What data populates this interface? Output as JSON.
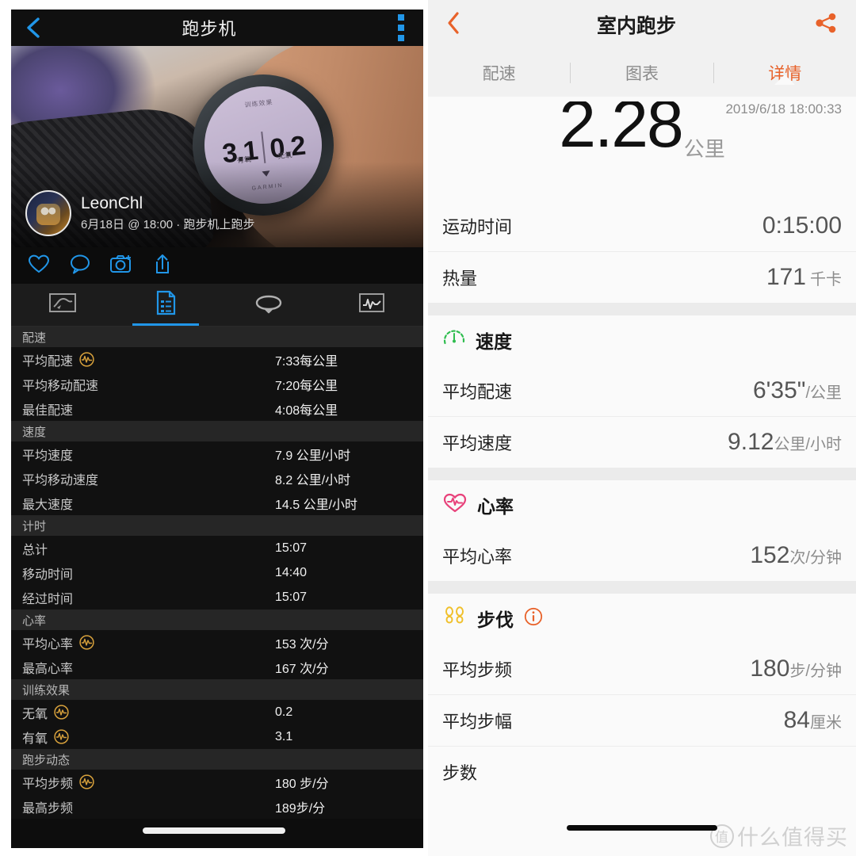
{
  "left_panel": {
    "appbar": {
      "title": "跑步机",
      "back_icon": "chevron-left-icon",
      "menu_icon": "overflow-menu-icon"
    },
    "post": {
      "user_name": "LeonChl",
      "subtitle": "6月18日 @ 18:00 · 跑步机上跑步",
      "watch": {
        "top_label": "训练效果",
        "value_left": "3.1",
        "value_right": "0.2",
        "label_left": "有氧",
        "label_right": "无氧",
        "brand": "GARMIN"
      }
    },
    "actions": [
      {
        "name": "like-icon",
        "label": "heart"
      },
      {
        "name": "comment-icon",
        "label": "comment"
      },
      {
        "name": "camera-icon",
        "label": "camera"
      },
      {
        "name": "share-icon",
        "label": "share"
      }
    ],
    "tabs": [
      {
        "name": "tab-map",
        "icon": "map-icon",
        "active": false
      },
      {
        "name": "tab-details",
        "icon": "document-list-icon",
        "active": true
      },
      {
        "name": "tab-laps",
        "icon": "loop-icon",
        "active": false
      },
      {
        "name": "tab-graphs",
        "icon": "graph-icon",
        "active": false
      }
    ],
    "sections": [
      {
        "title": "配速",
        "rows": [
          {
            "label": "平均配速",
            "value": "7:33每公里",
            "badge": "garmin-wave-icon"
          },
          {
            "label": "平均移动配速",
            "value": "7:20每公里",
            "badge": null
          },
          {
            "label": "最佳配速",
            "value": "4:08每公里",
            "badge": null
          }
        ]
      },
      {
        "title": "速度",
        "rows": [
          {
            "label": "平均速度",
            "value": "7.9 公里/小时",
            "badge": null
          },
          {
            "label": "平均移动速度",
            "value": "8.2 公里/小时",
            "badge": null
          },
          {
            "label": "最大速度",
            "value": "14.5 公里/小时",
            "badge": null
          }
        ]
      },
      {
        "title": "计时",
        "rows": [
          {
            "label": "总计",
            "value": "15:07",
            "badge": null
          },
          {
            "label": "移动时间",
            "value": "14:40",
            "badge": null
          },
          {
            "label": "经过时间",
            "value": "15:07",
            "badge": null
          }
        ]
      },
      {
        "title": "心率",
        "rows": [
          {
            "label": "平均心率",
            "value": "153 次/分",
            "badge": "garmin-wave-icon"
          },
          {
            "label": "最高心率",
            "value": "167 次/分",
            "badge": null
          }
        ]
      },
      {
        "title": "训练效果",
        "rows": [
          {
            "label": "无氧",
            "value": "0.2",
            "badge": "garmin-wave-icon"
          },
          {
            "label": "有氧",
            "value": "3.1",
            "badge": "garmin-wave-icon"
          }
        ]
      },
      {
        "title": "跑步动态",
        "rows": [
          {
            "label": "平均步频",
            "value": "180 步/分",
            "badge": "garmin-wave-icon"
          },
          {
            "label": "最高步频",
            "value": "189步/分",
            "badge": null
          }
        ]
      }
    ]
  },
  "right_panel": {
    "appbar": {
      "title": "室内跑步",
      "back_icon": "chevron-left-icon",
      "share_icon": "share-nodes-icon"
    },
    "tabs": [
      {
        "label": "配速",
        "active": false
      },
      {
        "label": "图表",
        "active": false
      },
      {
        "label": "详情",
        "active": true
      }
    ],
    "hero": {
      "timestamp": "2019/6/18 18:00:33",
      "value": "2.28",
      "unit": "公里"
    },
    "summary": [
      {
        "label": "运动时间",
        "value": "0:15:00",
        "unit": ""
      },
      {
        "label": "热量",
        "value": "171",
        "unit": "千卡"
      }
    ],
    "groups": [
      {
        "title": "速度",
        "icon": "speedometer-icon",
        "icon_color": "#2fbd4f",
        "rows": [
          {
            "label": "平均配速",
            "value": "6'35\"",
            "unit": "/公里"
          },
          {
            "label": "平均速度",
            "value": "9.12",
            "unit": "公里/小时"
          }
        ]
      },
      {
        "title": "心率",
        "icon": "heart-pulse-icon",
        "icon_color": "#e8417a",
        "rows": [
          {
            "label": "平均心率",
            "value": "152",
            "unit": "次/分钟"
          }
        ]
      },
      {
        "title": "步伐",
        "icon": "footprints-icon",
        "icon_color": "#f0c02c",
        "info_icon": "info-circle-icon",
        "rows": [
          {
            "label": "平均步频",
            "value": "180",
            "unit": "步/分钟"
          },
          {
            "label": "平均步幅",
            "value": "84",
            "unit": "厘米"
          },
          {
            "label": "步数",
            "value": "",
            "unit": ""
          }
        ]
      }
    ],
    "watermark": {
      "badge": "值",
      "text": "什么值得买"
    }
  },
  "colors": {
    "accent_orange": "#e8622a",
    "accent_blue": "#2196e8",
    "garmin_gold": "#d9a23c",
    "green": "#2fbd4f",
    "pink": "#e8417a",
    "yellow": "#f0c02c"
  }
}
